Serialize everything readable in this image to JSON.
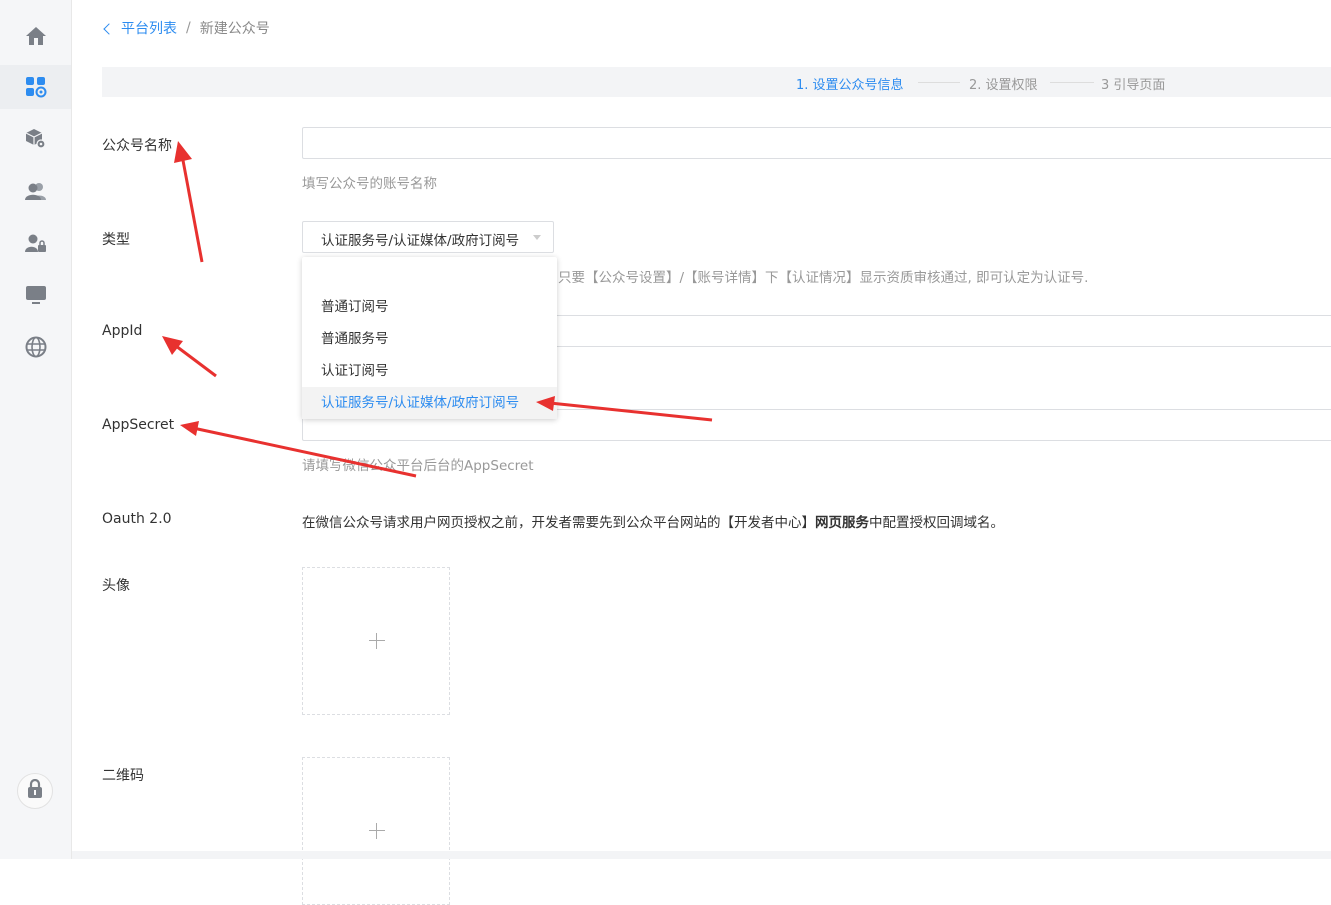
{
  "breadcrumb": {
    "back_label": "平台列表",
    "separator": "/",
    "current": "新建公众号"
  },
  "steps": [
    {
      "label": "1. 设置公众号信息",
      "active": true
    },
    {
      "label": "2. 设置权限",
      "active": false
    },
    {
      "label": "3 引导页面",
      "active": false
    }
  ],
  "sidebar": {
    "items": [
      {
        "icon": "home-icon"
      },
      {
        "icon": "apps-gear-icon",
        "active": true
      },
      {
        "icon": "cube-gear-icon"
      },
      {
        "icon": "users-icon"
      },
      {
        "icon": "user-lock-icon"
      },
      {
        "icon": "monitor-icon"
      },
      {
        "icon": "globe-icon"
      }
    ],
    "bottom_icon": "lock-icon"
  },
  "form": {
    "name_label": "公众号名称",
    "name_value": "",
    "name_help": "填写公众号的账号名称",
    "type_label": "类型",
    "type_value": "认证服务号/认证媒体/政府订阅号",
    "type_help_visible_part": "只要【公众号设置】/【账号详情】下【认证情况】显示资质审核通过, 即可认定为认证号.",
    "type_options": [
      "普通订阅号",
      "普通服务号",
      "认证订阅号",
      "认证服务号/认证媒体/政府订阅号"
    ],
    "appid_label": "AppId",
    "appid_value": "",
    "appsecret_label": "AppSecret",
    "appsecret_value": "",
    "appsecret_help": "请填写微信公众平台后台的AppSecret",
    "oauth_label": "Oauth 2.0",
    "oauth_text_before": "在微信公众号请求用户网页授权之前，开发者需要先到公众平台网站的【开发者中心】",
    "oauth_text_bold": "网页服务",
    "oauth_text_after": "中配置授权回调域名。",
    "avatar_label": "头像",
    "qrcode_label": "二维码"
  },
  "colors": {
    "accent": "#2d8cf0",
    "annotation_arrow": "#e8312f"
  }
}
